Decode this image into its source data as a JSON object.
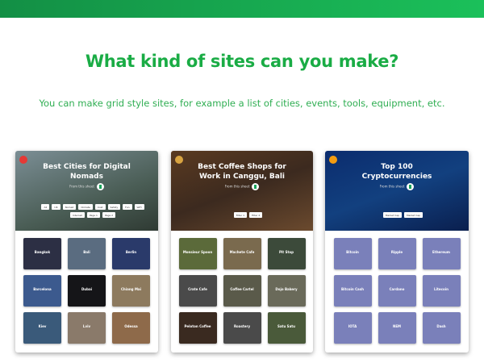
{
  "heading": "What kind of sites can you make?",
  "subheading": "You can make grid style sites, for example a list of cities, events, tools, equipment, etc.",
  "accent": "#1aac45",
  "cards": [
    {
      "title": "Best Cities for Digital Nomads",
      "byline": "From this sheet",
      "filters": [
        "All",
        "UK",
        "Nomad",
        "Climate",
        "Cost",
        "Safety",
        "Fun",
        "WiFi",
        "Internet",
        "Page 1",
        "Page 2"
      ],
      "tiles": [
        "Bangkok",
        "Bali",
        "Berlin",
        "Barcelona",
        "Dubai",
        "Chiang Mai",
        "Kiev",
        "Lviv",
        "Odessa"
      ]
    },
    {
      "title": "Best Coffee Shops for Work in Canggu, Bali",
      "byline": "From this sheet",
      "filters": [
        "Filter 1",
        "Filter 2"
      ],
      "tiles": [
        "Monsieur Spoon",
        "Machete Cafe",
        "Pit Stop",
        "Crate Cafe",
        "Coffee Cartel",
        "Dojo Bakery",
        "Peloton Coffee",
        "Roastery",
        "Satu Satu"
      ]
    },
    {
      "title": "Top 100 Cryptocurrencies",
      "byline": "From this sheet",
      "filters": [
        "Market Cap",
        "Market Cap"
      ],
      "tiles": [
        "Bitcoin",
        "Ripple",
        "Ethereum",
        "Bitcoin Cash",
        "Cardano",
        "Litecoin",
        "IOTA",
        "NEM",
        "Dash"
      ]
    }
  ]
}
